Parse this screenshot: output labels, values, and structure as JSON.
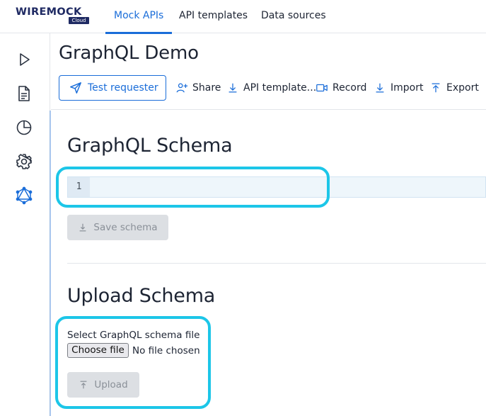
{
  "brand": {
    "name": "WIREMOCK",
    "badge": "Cloud"
  },
  "nav": {
    "tabs": [
      {
        "label": "Mock APIs",
        "active": true
      },
      {
        "label": "API templates",
        "active": false
      },
      {
        "label": "Data sources",
        "active": false
      }
    ]
  },
  "rail": {
    "icons": [
      "play-icon",
      "document-icon",
      "pie-chart-icon",
      "gear-icon",
      "graphql-icon"
    ]
  },
  "header": {
    "title": "GraphQL Demo",
    "test_requester_label": "Test requester",
    "actions": [
      {
        "label": "Share",
        "icon": "person-plus-icon"
      },
      {
        "label": "API template...",
        "icon": "download-icon"
      },
      {
        "label": "Record",
        "icon": "video-icon"
      },
      {
        "label": "Import",
        "icon": "import-icon"
      },
      {
        "label": "Export",
        "icon": "export-icon"
      }
    ]
  },
  "schema": {
    "title": "GraphQL Schema",
    "line_number": "1",
    "save_label": "Save schema"
  },
  "upload": {
    "title": "Upload Schema",
    "file_label": "Select GraphQL schema file",
    "choose_file_label": "Choose file",
    "file_status": "No file chosen",
    "upload_label": "Upload"
  },
  "colors": {
    "accent": "#1a6dd9",
    "highlight": "#1cc6e8",
    "brand": "#1f2a63"
  }
}
